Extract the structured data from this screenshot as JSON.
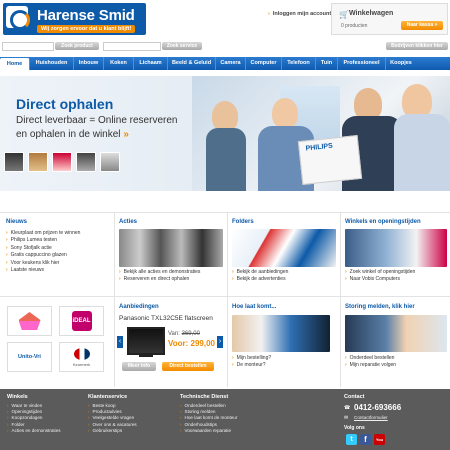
{
  "header": {
    "logo_prefix": "de",
    "logo_name": "Harense Smid",
    "slogan": "Wij zorgen ervoor dat u klant blijft!",
    "login": "Inloggen mijn account",
    "cart_title": "Winkelwagen",
    "cart_count": "0 producten",
    "cart_button": "Naar kassa »"
  },
  "search": {
    "product_button": "Zoek product",
    "service_button": "Zoek service",
    "business_button": "Bedrijven klikken hier"
  },
  "nav": [
    "Home",
    "Huishouden",
    "Inbouw",
    "Koken",
    "Lichaam",
    "Beeld & Geluid",
    "Camera",
    "Computer",
    "Telefoon",
    "Tuin",
    "Professioneel",
    "Koopjes"
  ],
  "banner": {
    "title": "Direct ophalen",
    "line1": "Direct leverbaar = Online reserveren",
    "line2": "en ophalen in de winkel",
    "arrows": "»",
    "brand": "PHILIPS"
  },
  "nieuws": {
    "title": "Nieuws",
    "items": [
      "Kleurplaat om prijzen te winnen",
      "Philips Lumea testen",
      "Sony Stofjalk actie",
      "Gratis cappuccino glazen",
      "Voor keukens klik hier",
      "Laatste nieuws"
    ]
  },
  "acties": {
    "title": "Acties",
    "items": [
      "Bekijk alle acties en demonstraties",
      "Reserveren en direct ophalen"
    ]
  },
  "folders": {
    "title": "Folders",
    "items": [
      "Bekijk de aanbiedingen",
      "Bekijk de advertenties"
    ]
  },
  "winkels": {
    "title": "Winkels en openingstijden",
    "items": [
      "Zoek winkel of openingstijden",
      "Naar Vobis Computers"
    ]
  },
  "aanbiedingen": {
    "title": "Aanbiedingen",
    "product": "Panasonic TXL32C5E flatscreen",
    "was_label": "Van:",
    "was_price": "369,00",
    "now_label": "Voor:",
    "now_price": "299,00",
    "info_button": "Meer info",
    "reserve_button": "Direct bestellen"
  },
  "hoelaat": {
    "title": "Hoe laat komt...",
    "items": [
      "Mijn bestelling?",
      "De monteur?"
    ]
  },
  "storing": {
    "title": "Storing melden, klik hier",
    "items": [
      "Onderdeel bestellen",
      "Mijn reparatie volgen"
    ]
  },
  "partners": [
    "Euronics",
    "iDEAL",
    "Unito-Vri",
    "Keurmerk"
  ],
  "footer": {
    "winkels_title": "Winkels",
    "winkels": [
      "Waar te vinden",
      "Openingstijden",
      "Koopzondagen",
      "Folder",
      "Acties en demonstraties"
    ],
    "klant_title": "Klantenservice",
    "klant": [
      "Beste koop",
      "Productadvies",
      "Veelgestelde vragen",
      "Over ons & vacatures",
      "Gebruikerstips"
    ],
    "tech_title": "Technische Dienst",
    "tech": [
      "Onderdeel bestellen",
      "Storing melden",
      "Hoe laat komt de monteur",
      "Onderhoudstips",
      "Voorwaarden reparatie"
    ],
    "contact_title": "Contact",
    "phone": "0412-693666",
    "contact_link": "Contactformulier",
    "follow": "Volg ons"
  },
  "colors": {
    "brand": "#0d5aa8",
    "accent": "#f08a00",
    "footer": "#5b5b5b"
  }
}
